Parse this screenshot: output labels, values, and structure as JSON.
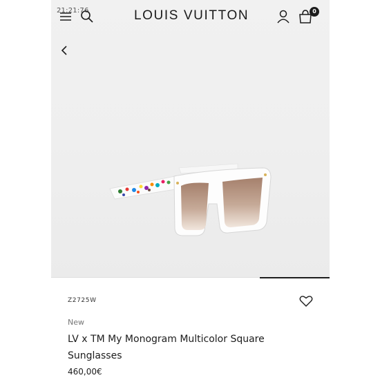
{
  "status_bar": {
    "time": "21:21:76"
  },
  "header": {
    "brand": "LOUIS VUITTON",
    "bag_count": "0",
    "icons": [
      "menu-icon",
      "search-icon",
      "account-icon",
      "shopping-bag-icon",
      "back-icon"
    ]
  },
  "gallery": {
    "image": "white-square-sunglasses-multicolor-monogram",
    "progress": 0.25
  },
  "product": {
    "sku": "Z2725W",
    "badge": "New",
    "name": "LV x TM My Monogram Multicolor Square Sunglasses",
    "price": "460,00€"
  },
  "colors": {
    "text": "#1c1c1c",
    "muted": "#767676",
    "photo_background": "#efefef",
    "lens": "#b08b77"
  }
}
